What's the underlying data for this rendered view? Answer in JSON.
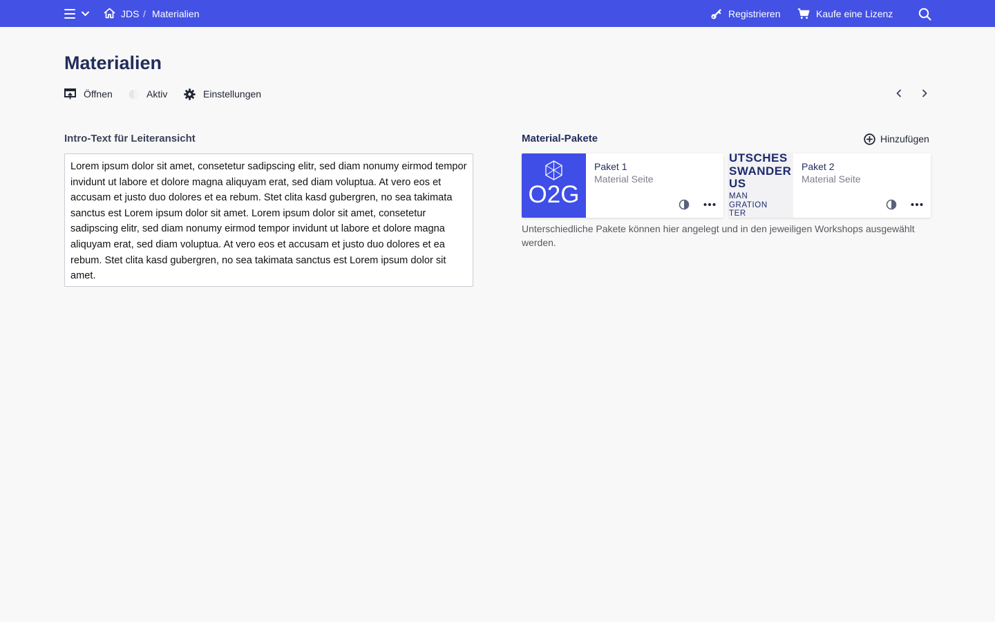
{
  "topbar": {
    "icons": {
      "menu": "hamburger-icon",
      "dropdown": "chevron-down-icon",
      "home": "home-icon",
      "register": "key-icon",
      "license": "cart-icon",
      "search": "search-icon"
    },
    "breadcrumb": {
      "root": "JDS",
      "separator": "/",
      "current": "Materialien"
    },
    "register_label": "Registrieren",
    "license_label": "Kaufe eine Lizenz",
    "color": "#4351e4"
  },
  "page": {
    "title": "Materialien"
  },
  "toolbar": {
    "open_label": "Öffnen",
    "active_label": "Aktiv",
    "settings_label": "Einstellungen",
    "icons": {
      "open": "open-icon",
      "active": "half-circle-icon",
      "settings": "gear-icon",
      "prev": "chevron-left-icon",
      "next": "chevron-right-icon"
    }
  },
  "intro": {
    "heading": "Intro-Text für Leiteransicht",
    "text": "Lorem ipsum dolor sit amet, consetetur sadipscing elitr, sed diam nonumy eirmod tempor invidunt ut labore et dolore magna aliquyam erat, sed diam voluptua. At vero eos et accusam et justo duo dolores et ea rebum. Stet clita kasd gubergren, no sea takimata sanctus est Lorem ipsum dolor sit amet. Lorem ipsum dolor sit amet, consetetur sadipscing elitr, sed diam nonumy eirmod tempor invidunt ut labore et dolore magna aliquyam erat, sed diam voluptua. At vero eos et accusam et justo duo dolores et ea rebum. Stet clita kasd gubergren, no sea takimata sanctus est Lorem ipsum dolor sit amet."
  },
  "packages": {
    "heading": "Material-Pakete",
    "add_label": "Hinzufügen",
    "help_text": "Unterschiedliche Pakete können hier angelegt und in den jeweiligen Workshops ausgewählt werden.",
    "items": [
      {
        "title": "Paket 1",
        "subtitle": "Material Seite",
        "thumb_text": "O2G",
        "thumb_color": "#3f4ee6"
      },
      {
        "title": "Paket 2",
        "subtitle": "Material Seite",
        "thumb_lines": [
          "UTSCHES",
          "SWANDER",
          "US",
          "MAN",
          "GRATION",
          "TER"
        ]
      }
    ]
  }
}
